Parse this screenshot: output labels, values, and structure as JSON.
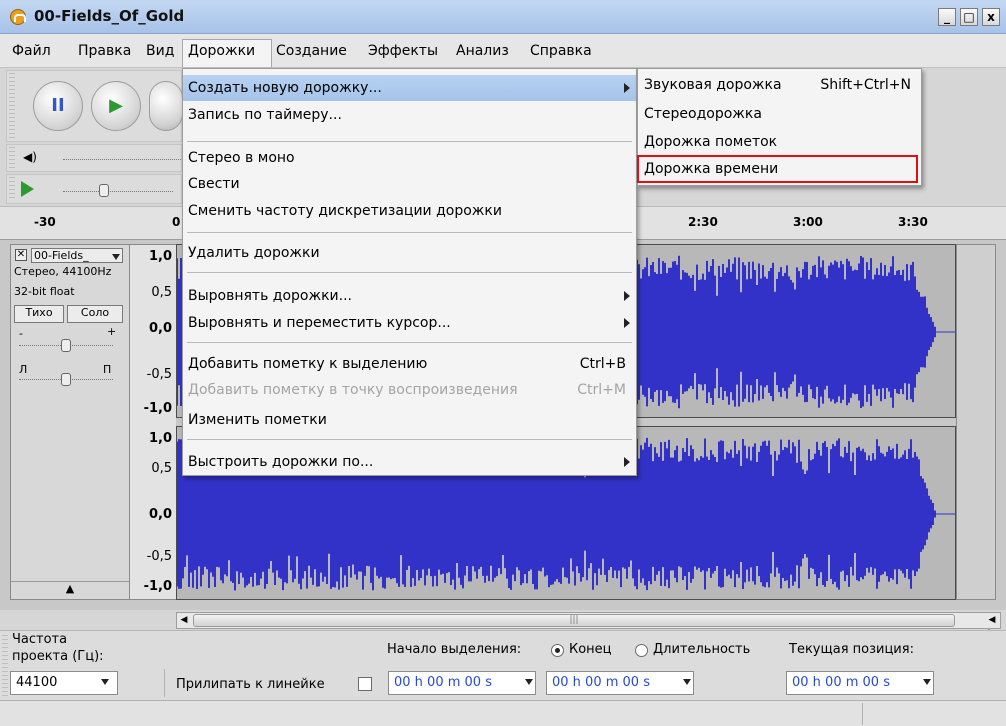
{
  "window": {
    "title": "00-Fields_Of_Gold",
    "min": "_",
    "max": "□",
    "close": "x"
  },
  "menubar": {
    "items": [
      "Файл",
      "Правка",
      "Вид",
      "Дорожки",
      "Создание",
      "Эффекты",
      "Анализ",
      "Справка"
    ],
    "active": "Дорожки"
  },
  "tracks_menu": {
    "items": [
      {
        "label": "Создать новую дорожку...",
        "shortcut": "",
        "submenu": true,
        "highlighted": true,
        "disabled": false
      },
      {
        "label": "Запись по таймеру...",
        "shortcut": "",
        "submenu": false,
        "highlighted": false,
        "disabled": false
      },
      {
        "label": "Стерео в моно",
        "shortcut": "",
        "submenu": false,
        "highlighted": false,
        "disabled": false
      },
      {
        "label": "Свести",
        "shortcut": "",
        "submenu": false,
        "highlighted": false,
        "disabled": false
      },
      {
        "label": "Сменить частоту дискретизации дорожки",
        "shortcut": "",
        "submenu": false,
        "highlighted": false,
        "disabled": false
      },
      {
        "label": "Удалить дорожки",
        "shortcut": "",
        "submenu": false,
        "highlighted": false,
        "disabled": false
      },
      {
        "label": "Выровнять дорожки...",
        "shortcut": "",
        "submenu": true,
        "highlighted": false,
        "disabled": false
      },
      {
        "label": "Выровнять и переместить курсор...",
        "shortcut": "",
        "submenu": true,
        "highlighted": false,
        "disabled": false
      },
      {
        "label": "Добавить пометку к выделению",
        "shortcut": "Ctrl+B",
        "submenu": false,
        "highlighted": false,
        "disabled": false
      },
      {
        "label": "Добавить пометку в точку воспроизведения",
        "shortcut": "Ctrl+M",
        "submenu": false,
        "highlighted": false,
        "disabled": true
      },
      {
        "label": "Изменить пометки",
        "shortcut": "",
        "submenu": false,
        "highlighted": false,
        "disabled": false
      },
      {
        "label": "Выстроить дорожки по...",
        "shortcut": "",
        "submenu": true,
        "highlighted": false,
        "disabled": false
      }
    ]
  },
  "new_track_submenu": {
    "items": [
      {
        "label": "Звуковая дорожка",
        "shortcut": "Shift+Ctrl+N"
      },
      {
        "label": "Стереодорожка",
        "shortcut": ""
      },
      {
        "label": "Дорожка пометок",
        "shortcut": ""
      },
      {
        "label": "Дорожка времени",
        "shortcut": ""
      }
    ],
    "marked": "Дорожка времени"
  },
  "ruler": {
    "ticks": [
      "-30",
      "0",
      "2:30",
      "3:00",
      "3:30"
    ]
  },
  "track": {
    "name": "00-Fields_",
    "close": "✕",
    "format": "Стерео, 44100Hz",
    "bitdepth": "32-bit float",
    "mute": "Тихо",
    "solo": "Соло",
    "gain_minus": "-",
    "gain_plus": "+",
    "pan_left": "Л",
    "pan_right": "П",
    "collapse": "▲",
    "scale_top": [
      "1,0",
      "0,5",
      "0,0",
      "-0,5",
      "-1,0"
    ],
    "scale_bottom": [
      "1,0",
      "0,5",
      "0,0",
      "-0,5",
      "-1,0"
    ]
  },
  "toolbar": {
    "pause": "II",
    "play": "▶",
    "volume_icon": "◀)"
  },
  "bottom": {
    "rate_label_1": "Частота",
    "rate_label_2": "проекта (Гц):",
    "rate_value": "44100",
    "snap_label": "Прилипать к линейке",
    "selection_start": "Начало выделения:",
    "end_label": "Конец",
    "length_label": "Длительность",
    "position_label": "Текущая позиция:",
    "time_1": "00 h 00 m 00 s",
    "time_2": "00 h 00 m 00 s",
    "time_3": "00 h 00 m 00 s"
  },
  "colors": {
    "wave": "#3232c8",
    "highlight": "#dd1111",
    "menu_hl": "#a5c3ea"
  }
}
